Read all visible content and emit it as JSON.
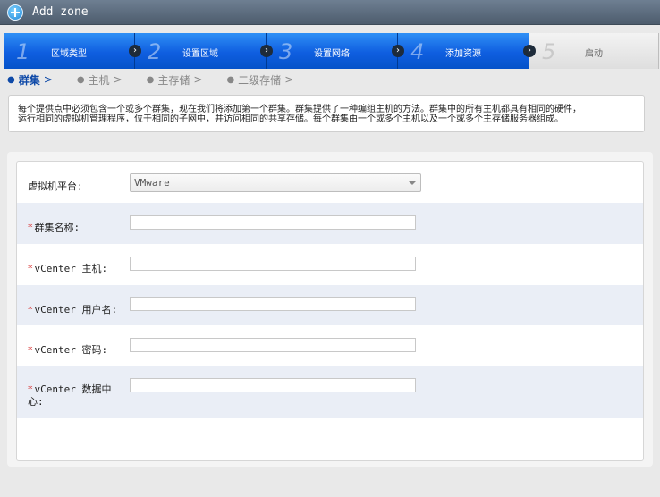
{
  "window": {
    "title": "Add zone",
    "icon": "add-zone-icon"
  },
  "steps": [
    {
      "num": "1",
      "label": "区域类型"
    },
    {
      "num": "2",
      "label": "设置区域"
    },
    {
      "num": "3",
      "label": "设置网络"
    },
    {
      "num": "4",
      "label": "添加资源"
    },
    {
      "num": "5",
      "label": "启动"
    }
  ],
  "subtabs": [
    {
      "label": "群集",
      "chevron": ">",
      "active": true
    },
    {
      "label": "主机",
      "chevron": ">"
    },
    {
      "label": "主存储",
      "chevron": ">"
    },
    {
      "label": "二级存储",
      "chevron": ">"
    }
  ],
  "description": {
    "line1": "每个提供点中必须包含一个或多个群集，现在我们将添加第一个群集。群集提供了一种编组主机的方法。群集中的所有主机都具有相同的硬件，",
    "line2": "运行相同的虚拟机管理程序，位于相同的子网中，并访问相同的共享存储。每个群集由一个或多个主机以及一个或多个主存储服务器组成。"
  },
  "form": {
    "hypervisor": {
      "label": "虚拟机平台:",
      "value": "VMware"
    },
    "cluster_name": {
      "label": "群集名称:",
      "value": ""
    },
    "vcenter_host": {
      "label": "vCenter 主机:",
      "value": ""
    },
    "vcenter_user": {
      "label": "vCenter 用户名:",
      "value": ""
    },
    "vcenter_password": {
      "label": "vCenter 密码:",
      "value": ""
    },
    "vcenter_datacenter": {
      "label_line1": "vCenter 数据中",
      "label_line2": "心:",
      "value": ""
    },
    "required_mark": "*"
  },
  "colors": {
    "step_active": "#0f5ee0",
    "required": "#d62828",
    "row_alt": "#eaeef6"
  }
}
